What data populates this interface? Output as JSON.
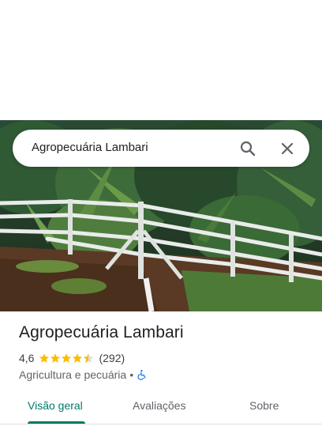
{
  "search": {
    "query": "Agropecuária Lambari"
  },
  "place": {
    "title": "Agropecuária Lambari",
    "rating": "4,6",
    "stars": 4.5,
    "review_count": "(292)",
    "category": "Agricultura e pecuária",
    "separator": "•"
  },
  "tabs": [
    {
      "label": "Visão geral",
      "active": true
    },
    {
      "label": "Avaliações",
      "active": false
    },
    {
      "label": "Sobre",
      "active": false
    }
  ],
  "colors": {
    "accent": "#00796b",
    "star": "#fbbc04",
    "accessibility": "#1a73e8"
  },
  "icons": {
    "search": "search-icon",
    "close": "close-icon",
    "accessibility": "wheelchair-accessible-icon"
  }
}
